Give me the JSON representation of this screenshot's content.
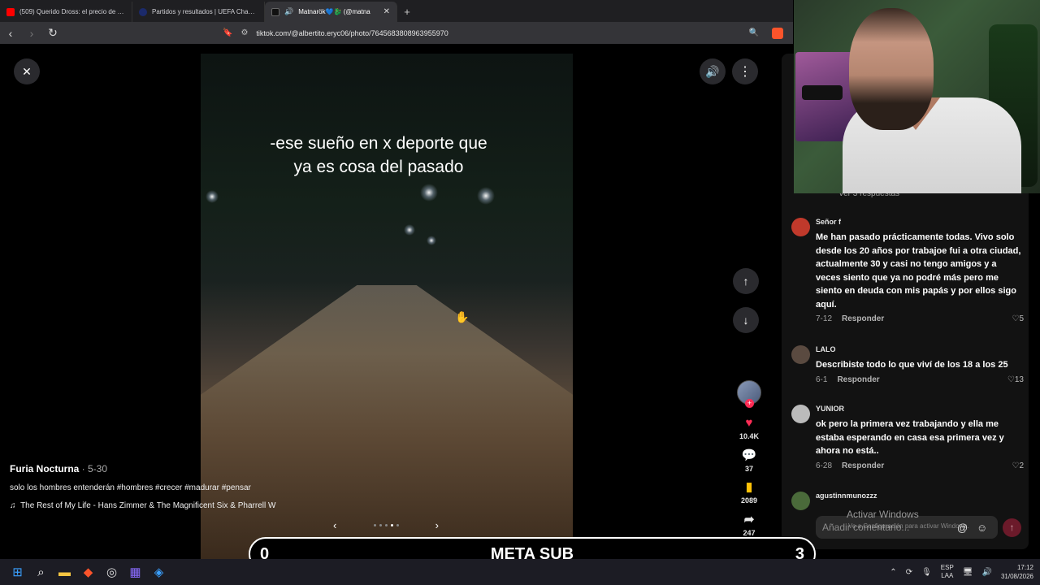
{
  "browser": {
    "tabs": [
      {
        "title": "(509) Querido Dross: el precio de fam",
        "favicon_color": "#ff0000",
        "active": false
      },
      {
        "title": "Partidos y resultados | UEFA Champio",
        "favicon_color": "#1b2a6b",
        "active": false
      },
      {
        "title": "Matnarök💙🐉 (@matna",
        "favicon_color": "#111111",
        "active": true
      }
    ],
    "url": "tiktok.com/@albertito.eryc06/photo/7645683808963955970"
  },
  "post": {
    "overlay_text_line1": "-ese sueño en x deporte que",
    "overlay_text_line2": "ya es cosa del pasado",
    "author": "Furia Nocturna",
    "date": " · 5-30",
    "description": "solo los hombres entenderán #hombres #crecer #madurar #pensar",
    "music": "The Rest of My Life - Hans Zimmer & The Magnificent Six & Pharrell W",
    "carousel_total": 5,
    "carousel_current": 4
  },
  "actions": {
    "likes": "10.4K",
    "comments": "37",
    "saves": "2089",
    "shares": "247"
  },
  "comments": {
    "replies_link": "Ver 3 respuestas",
    "items": [
      {
        "user": "Señor f",
        "text": "Me han pasado prácticamente todas. Vivo solo desde los 20 años por trabajoe fui a otra ciudad, actualmente 30 y casi no tengo amigos y a veces siento que ya no podré más pero me siento en deuda con mis papás y por ellos sigo aquí.",
        "date": "7-12",
        "reply": "Responder",
        "likes": "5",
        "avatar_color": "#c0392b"
      },
      {
        "user": "LALO",
        "text": "Describiste todo lo que viví de los 18 a los 25",
        "date": "6-1",
        "reply": "Responder",
        "likes": "13",
        "avatar_color": "#5a4a40"
      },
      {
        "user": "YUNIOR",
        "text": "ok pero la primera vez trabajando y ella me estaba esperando en casa esa primera vez y ahora no está..",
        "date": "6-28",
        "reply": "Responder",
        "likes": "2",
        "avatar_color": "#bbbbbb"
      },
      {
        "user": "agustinnmunozzz",
        "avatar_color": "#4a6a3a"
      }
    ],
    "input_placeholder": "Añadir comentario...",
    "at_icon": "@",
    "emoji_icon": "☺"
  },
  "windows_watermark": {
    "title": "Activar Windows",
    "subtitle": "Ve a Configuración para activar Windows."
  },
  "stream_banner": {
    "left_count": "0",
    "label": "META SUB",
    "right_count": "3"
  },
  "taskbar": {
    "lang_line1": "ESP",
    "lang_line2": "LAA",
    "time": "17:12",
    "date": "31/08/2026"
  },
  "colors": {
    "tiktok_red": "#fe2c55",
    "save_yellow": "#ffc107"
  }
}
